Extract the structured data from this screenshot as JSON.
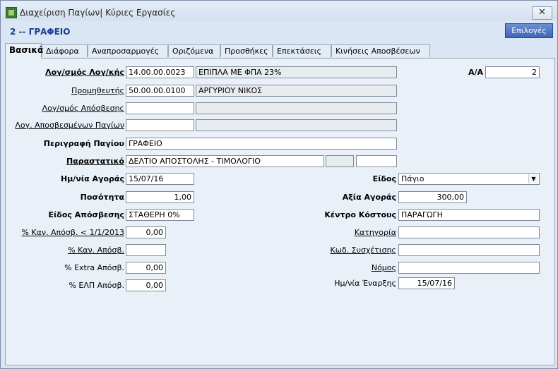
{
  "window": {
    "title": "Διαχείριση Παγίων| Κύριες Εργασίες",
    "close_label": "✕"
  },
  "header": {
    "record_title": "2 -- ΓΡΑΦΕΙΟ",
    "options_label": "Επιλογές"
  },
  "tabs": [
    {
      "label": "Βασικά"
    },
    {
      "label": "Διάφορα"
    },
    {
      "label": "Αναπροσαρμογές"
    },
    {
      "label": "Οριζόμενα"
    },
    {
      "label": "Προσθήκες"
    },
    {
      "label": "Επεκτάσεις"
    },
    {
      "label": "Κινήσεις Αποσβέσεων"
    }
  ],
  "form": {
    "account": {
      "label": "Λογ/σμός Λογ/κής",
      "code": "14.00.00.0023",
      "name": "ΕΠΙΠΛΑ ΜΕ ΦΠΑ 23%"
    },
    "supplier": {
      "label": "Προμηθευτής",
      "code": "50.00.00.0100",
      "name": "ΑΡΓΥΡΙΟΥ ΝΙΚΟΣ"
    },
    "depreciation_account": {
      "label": "Λογ/σμός Απόσβεσης",
      "code": "",
      "name": ""
    },
    "depreciated_assets_account": {
      "label": "Λογ. Αποσβεσμένων Παγίων",
      "code": "",
      "name": ""
    },
    "description": {
      "label": "Περιγραφή Παγίου",
      "value": "ΓΡΑΦΕΙΟ"
    },
    "document": {
      "label": "Παραστατικό",
      "value": "ΔΕΛΤΙΟ ΑΠΟΣΤΟΛΗΣ - ΤΙΜΟΛΟΓΙΟ",
      "extra1": "",
      "extra2": ""
    },
    "purchase_date": {
      "label": "Ημ/νία Αγοράς",
      "value": "15/07/16"
    },
    "quantity": {
      "label": "Ποσότητα",
      "value": "1,00"
    },
    "depreciation_type": {
      "label": "Είδος Απόσβεσης",
      "value": "ΣΤΑΘΕΡΗ 0%"
    },
    "rate_before_2013": {
      "label": "% Καν. Απόσβ. < 1/1/2013",
      "value": "0,00"
    },
    "normal_rate": {
      "label": "% Καν. Απόσβ.",
      "value": ""
    },
    "extra_rate": {
      "label": "% Extra Απόσβ.",
      "value": "0,00"
    },
    "elp_rate": {
      "label": "%  ΕΛΠ Απόσβ.",
      "value": "0,00"
    },
    "serial": {
      "label": "Α/Α",
      "value": "2"
    },
    "kind": {
      "label": "Είδος",
      "value": "Πάγιο"
    },
    "purchase_value": {
      "label": "Αξία Αγοράς",
      "value": "300,00"
    },
    "cost_center": {
      "label": "Κέντρο Κόστους",
      "value": "ΠΑΡΑΓΩΓΗ"
    },
    "category": {
      "label": "Κατηγορία",
      "value": ""
    },
    "relation_code": {
      "label": "Κωδ. Συσχέτισης",
      "value": ""
    },
    "county": {
      "label": "Νόμος",
      "value": ""
    },
    "start_date": {
      "label": "Ημ/νία Έναρξης",
      "value": "15/07/16"
    }
  },
  "colors": {
    "accent": "#1a3d8f",
    "options_button": "#3f66b8",
    "panel": "#eaf0f8"
  }
}
